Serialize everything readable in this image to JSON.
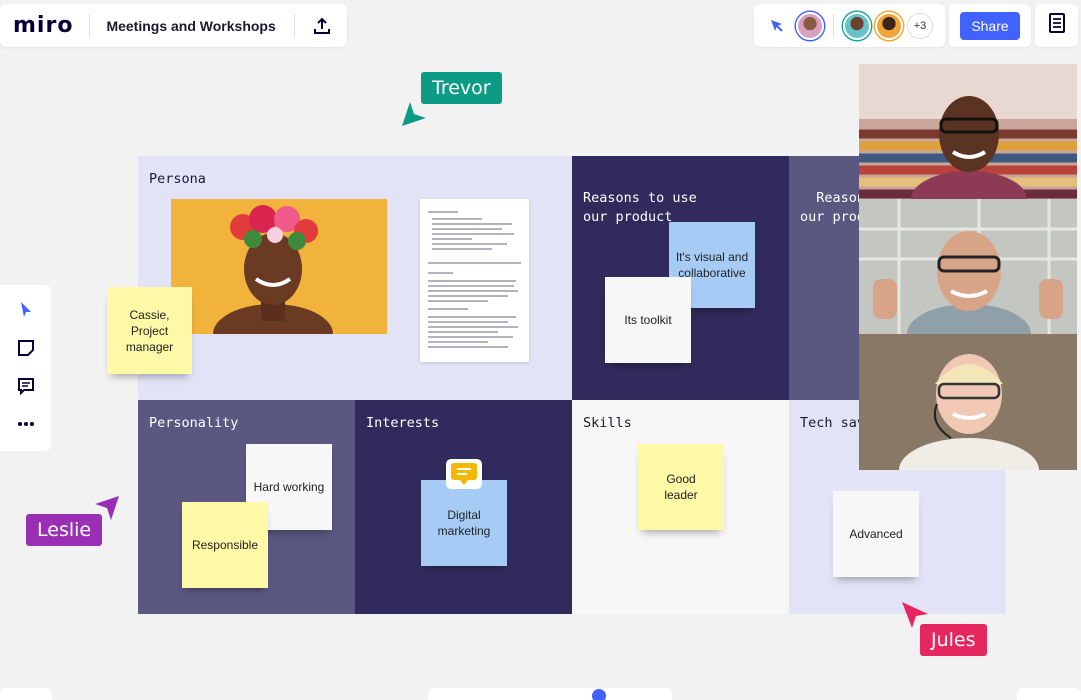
{
  "app": {
    "logo": "miro",
    "board_title": "Meetings and Workshops"
  },
  "header": {
    "share_label": "Share",
    "more_collaborators": "+3"
  },
  "colors": {
    "accent": "#4262ff",
    "trevor": "#0e9b86",
    "leslie": "#9a2fb5",
    "jules": "#e5265f"
  },
  "toolbar": {
    "icons": [
      "select-cursor-icon",
      "sticky-note-icon",
      "comment-icon",
      "more-icon"
    ]
  },
  "board": {
    "cells": {
      "persona": "Persona",
      "reasons1": "Reasons to use\nour product",
      "reasons2": "Reasons to use\nour product",
      "personality": "Personality",
      "interests": "Interests",
      "skills": "Skills",
      "techsavvy": "Tech savvy"
    },
    "stickies": {
      "cassie": "Cassie,\nProject\nmanager",
      "visual": "It's visual and\ncollaborative",
      "toolkit": "Its toolkit",
      "hardworking": "Hard working",
      "responsible": "Responsible",
      "digital": "Digital\nmarketing",
      "leader": "Good\nleader",
      "advanced": "Advanced"
    }
  },
  "cursors": {
    "trevor": "Trevor",
    "leslie": "Leslie",
    "jules": "Jules"
  }
}
